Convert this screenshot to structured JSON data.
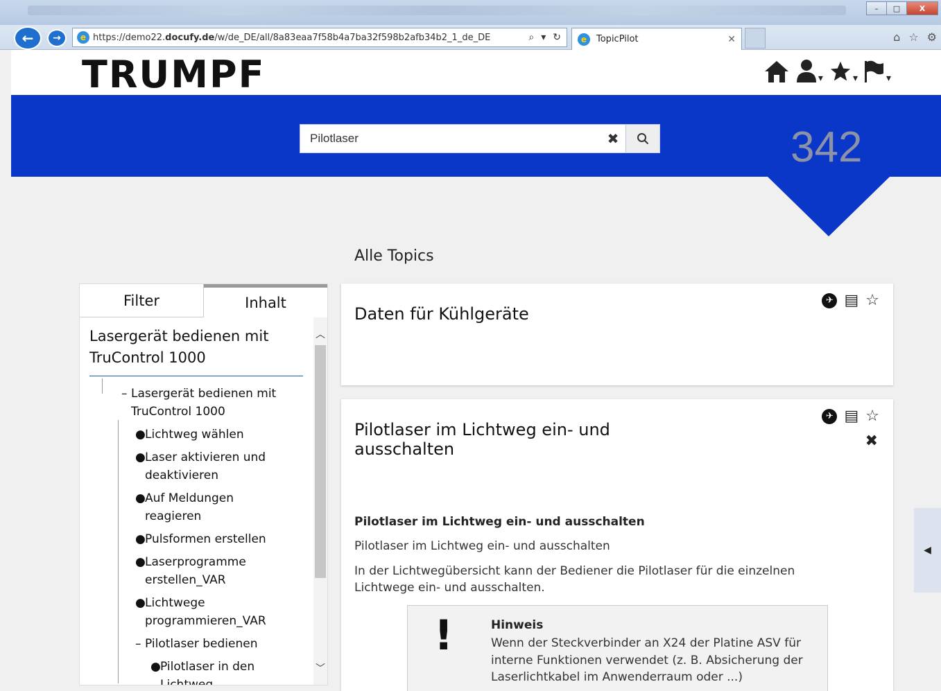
{
  "browser": {
    "url_prefix": "https://demo22.",
    "url_domain": "docufy.de",
    "url_path": "/w/de_DE/all/8a83eaa7f58b4a7ba32f598b2afb34b2_1_de_DE",
    "tab_title": "TopicPilot",
    "window_buttons": [
      "–",
      "□",
      "X"
    ]
  },
  "header": {
    "logo": "TRUMPF"
  },
  "search": {
    "value": "Pilotlaser",
    "result_count": "342"
  },
  "section_title": "Alle Topics",
  "left_panel": {
    "tabs": [
      "Filter",
      "Inhalt"
    ],
    "tree_title": "Lasergerät bedienen mit TruControl 1000",
    "nodes": [
      {
        "mark": "–",
        "label": "Lasergerät bedienen mit TruControl 1000"
      },
      {
        "mark": "●",
        "label": "Lichtweg wählen"
      },
      {
        "mark": "●",
        "label": "Laser aktivieren und deaktivieren"
      },
      {
        "mark": "●",
        "label": "Auf Meldungen reagieren"
      },
      {
        "mark": "●",
        "label": "Pulsformen erstellen"
      },
      {
        "mark": "●",
        "label": "Laserprogramme erstellen_VAR"
      },
      {
        "mark": "●",
        "label": "Lichtwege programmieren_VAR"
      },
      {
        "mark": "–",
        "label": "Pilotlaser bedienen"
      },
      {
        "mark": "●",
        "label": "Pilotlaser in den Lichtweg..."
      }
    ]
  },
  "results": [
    {
      "title": "Daten für Kühlgeräte"
    },
    {
      "title": "Pilotlaser im Lichtweg ein- und ausschalten",
      "heading": "Pilotlaser im Lichtweg ein- und ausschalten",
      "subtitle": "Pilotlaser im Lichtweg ein- und ausschalten",
      "paragraph": "In der Lichtwegübersicht kann der Bediener die Pilotlaser für die einzelnen Lichtwege ein- und ausschalten.",
      "note_heading": "Hinweis",
      "note_text": "Wenn der Steckverbinder an X24 der Platine ASV für interne Funktionen verwendet (z. B. Absicherung der Laserlichtkabel im Anwenderraum oder ...)"
    }
  ],
  "colors": {
    "brand_blue": "#0a37c8",
    "count_grey": "#8c93a8"
  }
}
